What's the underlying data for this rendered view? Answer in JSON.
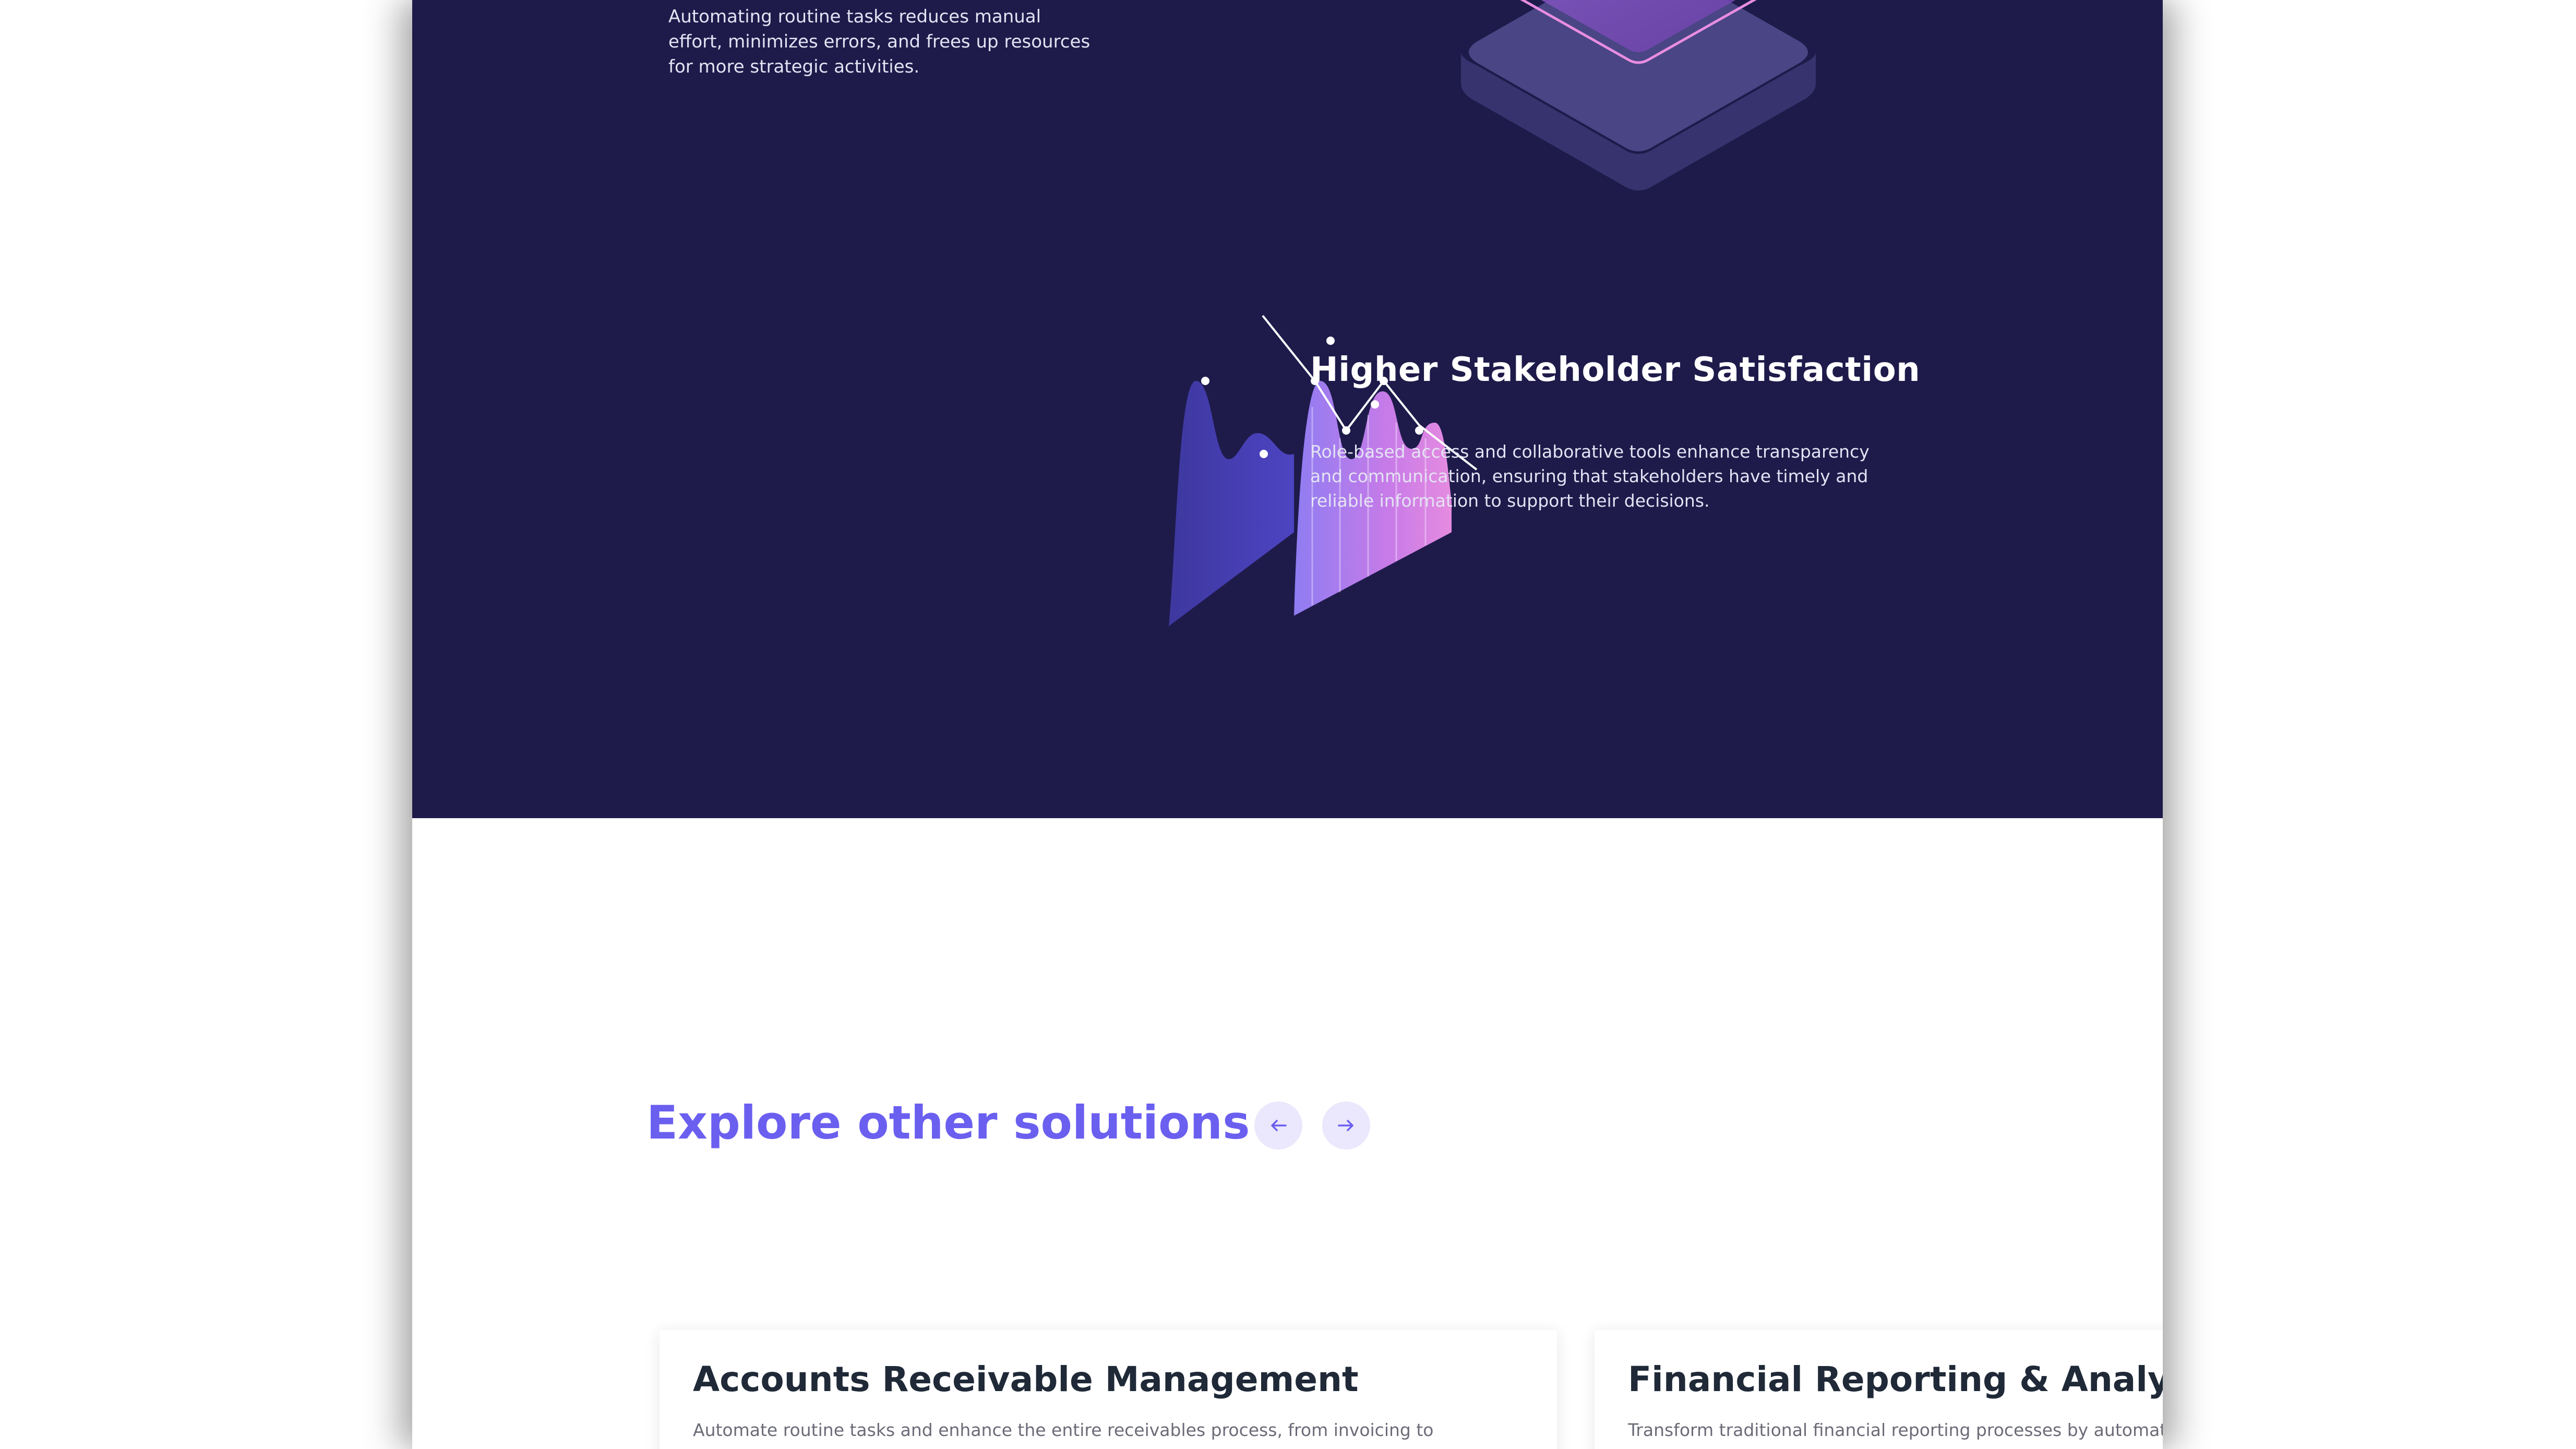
{
  "benefit_top": {
    "description": "Automating routine tasks reduces manual effort, minimizes errors, and frees up resources for more strategic activities."
  },
  "feature": {
    "title": "Higher Stakeholder Satisfaction",
    "description": "Role-based access and collaborative tools enhance transparency and communication, ensuring that stakeholders have timely and reliable information to support their decisions."
  },
  "solutions": {
    "title": "Explore other solutions",
    "prev_icon": "arrow-left-icon",
    "next_icon": "arrow-right-icon",
    "cards": [
      {
        "title": "Accounts Receivable Management",
        "description": "Automate routine tasks and enhance the entire receivables process, from invoicing to"
      },
      {
        "title": "Financial Reporting & Analysis",
        "description": "Transform traditional financial reporting processes by automating"
      }
    ]
  },
  "colors": {
    "dark_background": "#1e1b4b",
    "accent": "#6b5ff0",
    "nav_button_bg": "#ebe7fc"
  }
}
